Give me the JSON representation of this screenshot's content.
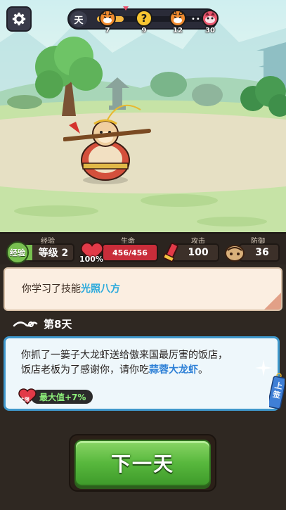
{
  "settings": {
    "icon": "gear-icon"
  },
  "progress": {
    "label": "天",
    "fill": 0.25,
    "nodes": [
      {
        "icon": "fox-enemy-icon",
        "num": "7"
      },
      {
        "icon": "question-mark-icon",
        "num": "9"
      },
      {
        "icon": "fox-enemy-icon",
        "num": "12"
      },
      {
        "icon": "boss-enemy-icon",
        "num": "30"
      }
    ],
    "dots": "•••"
  },
  "stats": {
    "exp": {
      "caption": "经验",
      "badge": "经验",
      "value": "等级 2"
    },
    "hp": {
      "caption": "生命",
      "value": "456/456",
      "pct": "100%",
      "fill": 1.0
    },
    "atk": {
      "caption": "攻击",
      "value": "100"
    },
    "def": {
      "caption": "防御",
      "value": "36"
    }
  },
  "message": {
    "prefix": "你学习了技能",
    "skill": "光照八方"
  },
  "day": {
    "text": "第8天"
  },
  "event": {
    "text_line1": "你抓了一篓子大龙虾送给傲来国最厉害的饭店，",
    "text_line2_prefix": "饭店老板为了感谢你，请你吃",
    "dish": "蒜蓉大龙虾",
    "text_line2_suffix": "。",
    "reward": {
      "badge": "上限",
      "text": "最大值+7%"
    },
    "sign": "上签"
  },
  "next_button": {
    "label": "下一天"
  },
  "colors": {
    "accent_green": "#58b83d",
    "hp_red": "#c92d3a",
    "highlight_blue": "#2aa9dc"
  }
}
